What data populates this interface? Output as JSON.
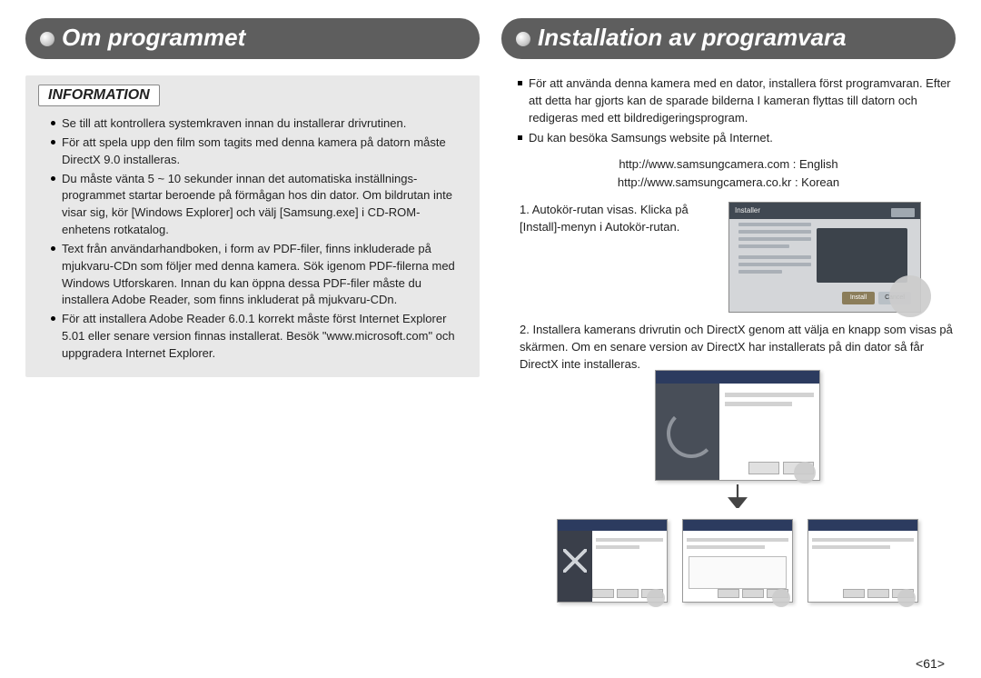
{
  "page_number": "61",
  "left": {
    "title": "Om programmet",
    "info_label": "INFORMATION",
    "items": [
      "Se till att kontrollera systemkraven innan du installerar drivrutinen.",
      "För att spela upp den film som tagits med denna kamera på datorn måste DirectX 9.0 installeras.",
      "Du måste vänta 5 ~ 10 sekunder innan det automatiska inställnings-programmet startar beroende på förmågan hos din dator. Om bildrutan inte visar sig, kör [Windows Explorer] och välj [Samsung.exe] i CD-ROM-enhetens rotkatalog.",
      "Text från användarhandboken, i form av PDF-filer, finns inkluderade på mjukvaru-CDn som följer med denna kamera. Sök igenom PDF-filerna med Windows Utforskaren. Innan du kan öppna dessa PDF-filer måste du installera Adobe Reader, som finns inkluderat på mjukvaru-CDn.",
      "För att installera Adobe Reader 6.0.1 korrekt måste först Internet Explorer 5.01 eller senare version finnas installerat. Besök \"www.microsoft.com\" och uppgradera Internet Explorer."
    ]
  },
  "right": {
    "title": "Installation av programvara",
    "intro_items": [
      "För att använda denna kamera med en dator, installera först programvaran. Efter att detta har gjorts kan de sparade bilderna I kameran flyttas till datorn och redigeras med ett bildredigeringsprogram.",
      "Du kan besöka Samsungs website på Internet."
    ],
    "links": {
      "english": "http://www.samsungcamera.com : English",
      "korean": "http://www.samsungcamera.co.kr : Korean"
    },
    "steps": {
      "s1": "1. Autokör-rutan visas. Klicka på [Install]-menyn i Autokör-rutan.",
      "s2": "2. Installera kamerans drivrutin och DirectX genom att välja en knapp som visas på skärmen. Om en senare version av DirectX har installerats på din dator så får DirectX inte installeras."
    },
    "installer": {
      "header": "Installer",
      "btn_install": "Install",
      "btn_cancel": "Cancel"
    }
  }
}
